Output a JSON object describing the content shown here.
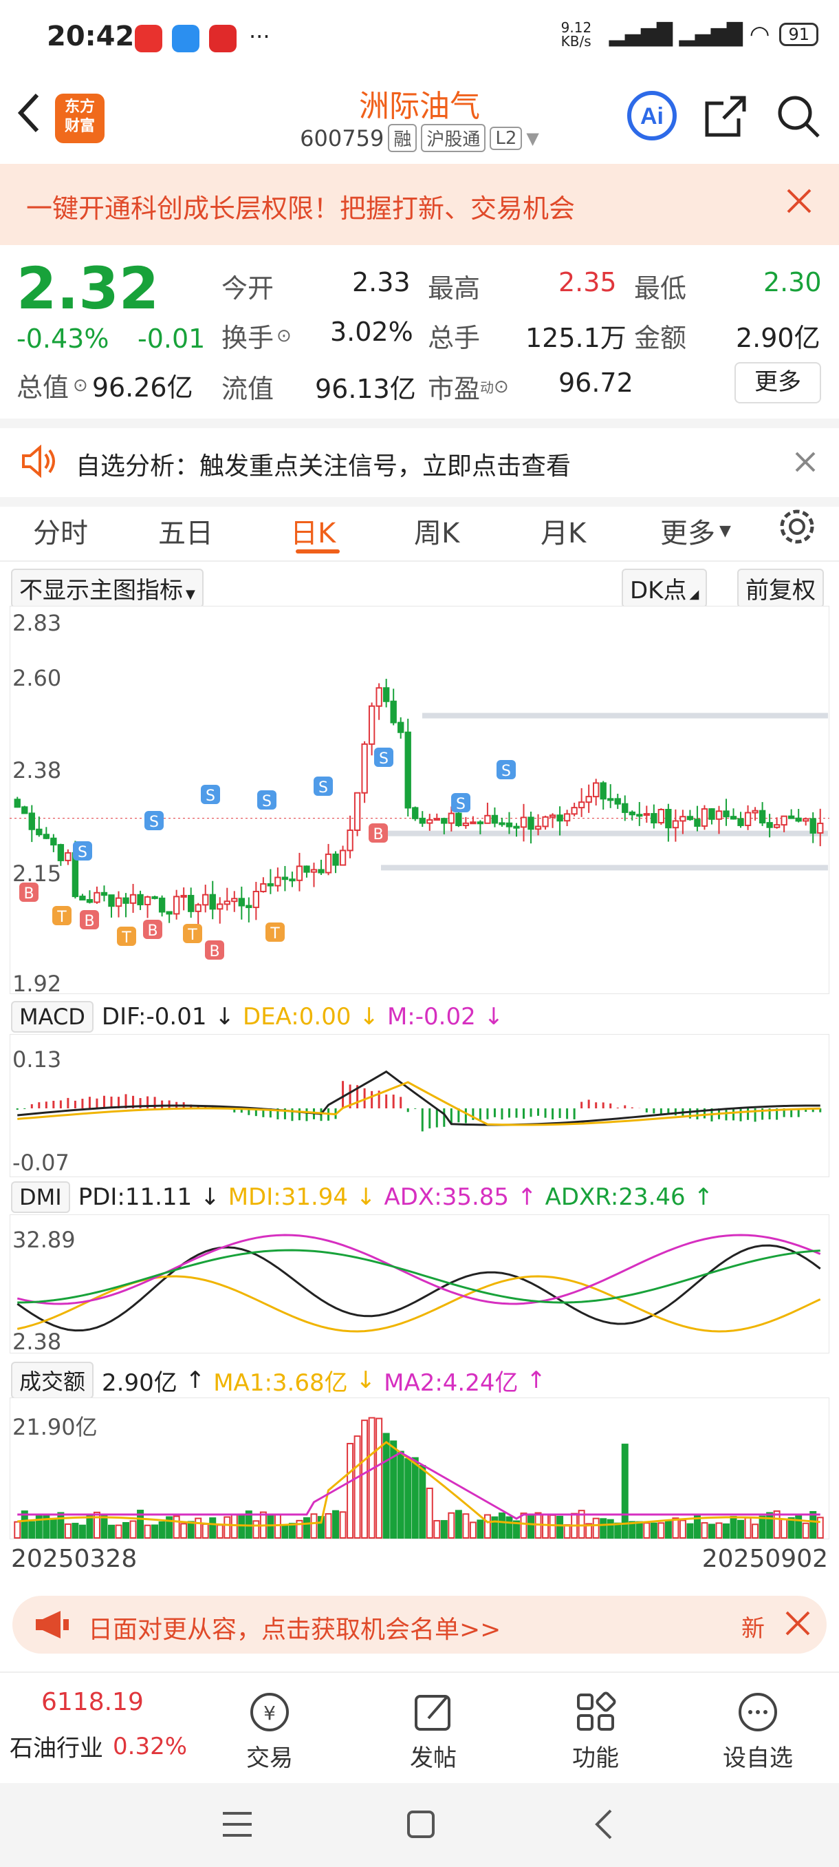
{
  "status": {
    "time": "20:42",
    "net_speed": "9.12 KB/s",
    "battery": "91"
  },
  "header": {
    "title": "洲际油气",
    "code": "600759",
    "tags": [
      "融",
      "沪股通",
      "L2"
    ],
    "logo": [
      "东方",
      "财富"
    ]
  },
  "banner": {
    "text": "一键开通科创成长层权限！把握打新、交易机会"
  },
  "quote": {
    "price": "2.32",
    "change_pct": "-0.43%",
    "change": "-0.01",
    "open_label": "今开",
    "open": "2.33",
    "high_label": "最高",
    "high": "2.35",
    "low_label": "最低",
    "low": "2.30",
    "turnover_label": "换手",
    "turnover": "3.02%",
    "volume_label": "总手",
    "volume": "125.1万",
    "amount_label": "金额",
    "amount": "2.90亿",
    "mktcap_label": "总值",
    "mktcap": "96.26亿",
    "float_label": "流值",
    "float": "96.13亿",
    "pe_label": "市盈",
    "pe_sup": "动",
    "pe": "96.72",
    "more": "更多"
  },
  "analysis": {
    "text": "自选分析：触发重点关注信号，立即点击查看"
  },
  "tabs": [
    "分时",
    "五日",
    "日K",
    "周K",
    "月K",
    "更多"
  ],
  "active_tab": "日K",
  "chart_controls": {
    "indicator": "不显示主图指标",
    "dk": "DK点",
    "adjust": "前复权"
  },
  "chart_data": [
    {
      "type": "candlestick",
      "ylabels": [
        "2.83",
        "2.60",
        "2.38",
        "2.15",
        "1.92"
      ],
      "levels": [
        2.6,
        2.29,
        2.2
      ],
      "signals": {
        "S": [
          "S",
          "S",
          "S",
          "S",
          "S",
          "S",
          "S",
          "S"
        ],
        "B": [
          "B",
          "B",
          "B",
          "B",
          "B"
        ],
        "T": [
          "T",
          "T",
          "T",
          "T"
        ]
      }
    },
    {
      "type": "line",
      "name": "MACD",
      "dif_label": "DIF:-0.01",
      "dea_label": "DEA:0.00",
      "m_label": "M:-0.02",
      "ylabels": [
        "0.13",
        "-0.07"
      ]
    },
    {
      "type": "line",
      "name": "DMI",
      "pdi_label": "PDI:11.11",
      "mdi_label": "MDI:31.94",
      "adx_label": "ADX:35.85",
      "adxr_label": "ADXR:23.46",
      "ylabels": [
        "32.89",
        "2.38"
      ]
    },
    {
      "type": "bar",
      "name": "成交额",
      "value_label": "2.90亿",
      "ma1_label": "MA1:3.68亿",
      "ma2_label": "MA2:4.24亿",
      "ylabels": [
        "21.90亿"
      ],
      "x_start": "20250328",
      "x_end": "20250902"
    }
  ],
  "colors": {
    "up": "#e0363c",
    "down": "#18a23a",
    "accent": "#f0601a",
    "dea": "#f0b400",
    "m": "#d62fc0"
  },
  "promo": {
    "text": "日面对更从容，点击获取机会名单>>",
    "new": "新"
  },
  "bottom": {
    "index_value": "6118.19",
    "index_name": "石油行业",
    "index_change": "0.32%",
    "items": [
      "交易",
      "发帖",
      "功能",
      "设自选"
    ]
  }
}
